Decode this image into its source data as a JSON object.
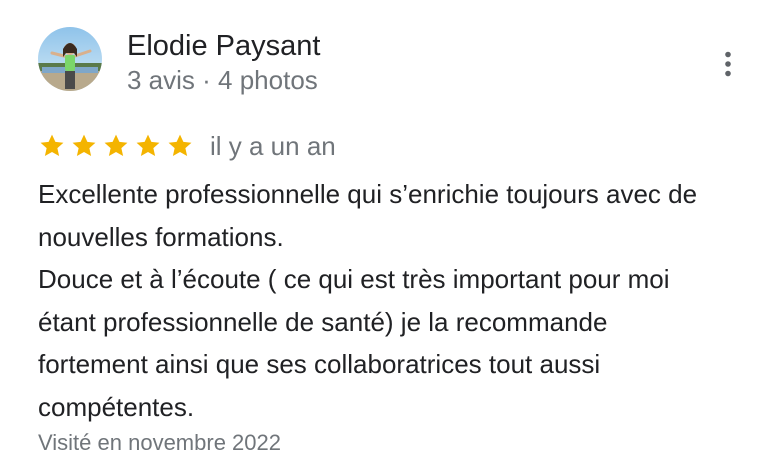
{
  "review": {
    "author": {
      "name": "Elodie Paysant",
      "meta": "3 avis · 4 photos",
      "avatar_icon": "profile-photo"
    },
    "menu_icon": "more-vert-icon",
    "rating": {
      "stars": 5,
      "max": 5,
      "star_color": "#f4b400",
      "date": "il y a un an"
    },
    "text_lines": [
      "Excellente professionnelle qui s’enrichie toujours avec de",
      "nouvelles formations.",
      "Douce et à l’écoute ( ce qui est très important pour moi",
      "étant professionnelle de santé) je la recommande",
      "fortement ainsi que ses collaboratrices tout aussi",
      "compétentes."
    ],
    "visit": "Visité en novembre 2022"
  }
}
